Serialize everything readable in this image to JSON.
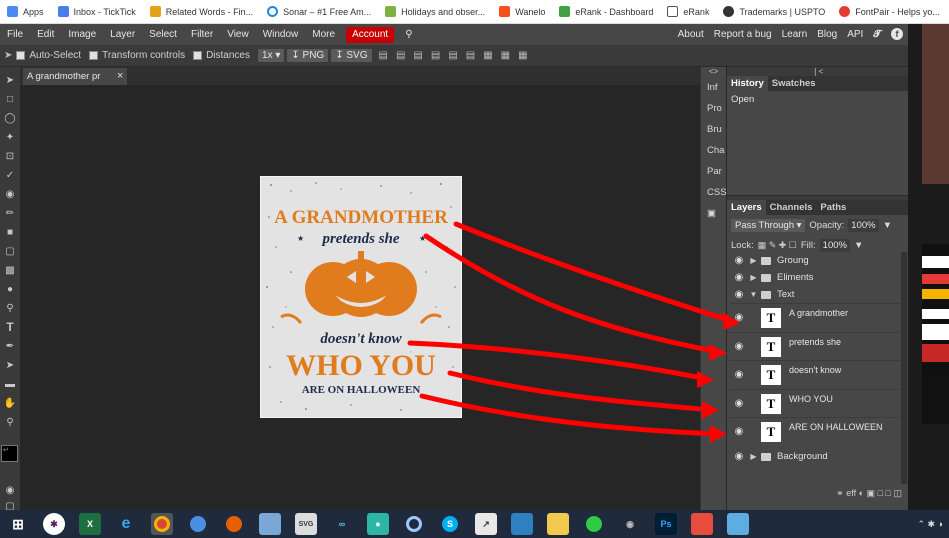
{
  "bookmarks": [
    {
      "label": "Apps",
      "color": "#4c8bf5"
    },
    {
      "label": "Inbox - TickTick",
      "color": "#4a7dea"
    },
    {
      "label": "Related Words - Fin...",
      "color": "#e3a21a"
    },
    {
      "label": "Sonar – #1 Free Am...",
      "color": "#1e88e5"
    },
    {
      "label": "Holidays and obser...",
      "color": "#7cb342"
    },
    {
      "label": "Wanelo",
      "color": "#f4511e"
    },
    {
      "label": "eRank - Dashboard",
      "color": "#43a047"
    },
    {
      "label": "eRank",
      "color": "#555555"
    },
    {
      "label": "Trademarks | USPTO",
      "color": "#333333"
    },
    {
      "label": "FontPair - Helps yo...",
      "color": "#e53935"
    }
  ],
  "menubar": {
    "items": [
      "File",
      "Edit",
      "Image",
      "Layer",
      "Select",
      "Filter",
      "View",
      "Window",
      "More"
    ],
    "account": "Account",
    "right": [
      "About",
      "Report a bug",
      "Learn",
      "Blog",
      "API"
    ]
  },
  "options": {
    "auto_select": "Auto-Select",
    "transform_controls": "Transform controls",
    "distances": "Distances",
    "zoom": "1x",
    "png": "PNG",
    "svg": "SVG"
  },
  "document": {
    "tab_title": "A grandmother pr",
    "close": "×"
  },
  "poster": {
    "line1": "A GRANDMOTHER",
    "line2": "pretends she",
    "line3": "doesn't know",
    "line4": "WHO YOU",
    "line5": "ARE ON HALLOWEEN",
    "orange": "#e07c1e",
    "navy": "#1e2a4a"
  },
  "strip": {
    "top": "<>",
    "items": [
      "Inf",
      "Pro",
      "Bru",
      "Cha",
      "Par",
      "CSS"
    ]
  },
  "history_panel": {
    "tabs": [
      "History",
      "Swatches"
    ],
    "items": [
      "Open"
    ]
  },
  "layers_panel": {
    "tabs": [
      "Layers",
      "Channels",
      "Paths"
    ],
    "blend_mode": "Pass Through",
    "opacity_label": "Opacity:",
    "opacity": "100%",
    "lock_label": "Lock:",
    "fill_label": "Fill:",
    "fill": "100%",
    "groups": [
      {
        "name": "Groung",
        "expanded": false
      },
      {
        "name": "Eliments",
        "expanded": false
      },
      {
        "name": "Text",
        "expanded": true
      }
    ],
    "text_layers": [
      "A grandmother",
      "pretends she",
      "doesn't know",
      "WHO YOU",
      "ARE ON HALLOWEEN"
    ],
    "bottom_group": "Background",
    "footer": "eff"
  },
  "annotation_color": "#ff0000"
}
